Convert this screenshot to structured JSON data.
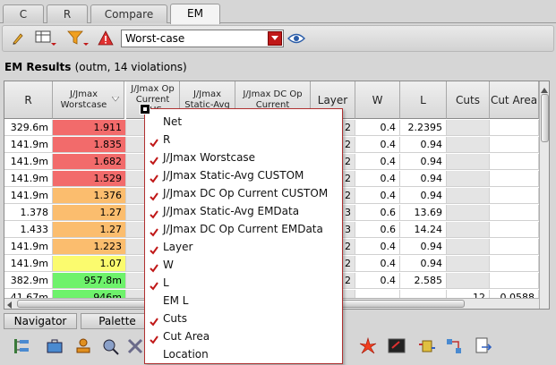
{
  "tabs": [
    {
      "label": "C",
      "active": false
    },
    {
      "label": "R",
      "active": false
    },
    {
      "label": "Compare",
      "active": false
    },
    {
      "label": "EM",
      "active": true
    }
  ],
  "toolbar": {
    "filter_value": "Worst-case",
    "icons": [
      "pencil-icon",
      "table-settings-icon",
      "filter-icon",
      "warning-icon",
      "eye-icon"
    ]
  },
  "results": {
    "title": "EM Results",
    "subtitle": "(outm, 14 violations)"
  },
  "columns": [
    {
      "label": "R"
    },
    {
      "label": "J/Jmax Worstcase"
    },
    {
      "label": "J/Jmax Op Current CUS"
    },
    {
      "label": "J/Jmax Static-Avg"
    },
    {
      "label": "J/Jmax DC Op Current"
    },
    {
      "label": "Layer"
    },
    {
      "label": "W"
    },
    {
      "label": "L"
    },
    {
      "label": "Cuts"
    },
    {
      "label": "Cut Area"
    }
  ],
  "rows": [
    {
      "r": "329.6m",
      "j": "1.911",
      "layer": "2",
      "w": "0.4",
      "l": "2.2395",
      "cuts": "",
      "cutarea": "",
      "color": "#f26b6b"
    },
    {
      "r": "141.9m",
      "j": "1.835",
      "layer": "2",
      "w": "0.4",
      "l": "0.94",
      "cuts": "",
      "cutarea": "",
      "color": "#f26b6b"
    },
    {
      "r": "141.9m",
      "j": "1.682",
      "layer": "2",
      "w": "0.4",
      "l": "0.94",
      "cuts": "",
      "cutarea": "",
      "color": "#f26b6b"
    },
    {
      "r": "141.9m",
      "j": "1.529",
      "layer": "2",
      "w": "0.4",
      "l": "0.94",
      "cuts": "",
      "cutarea": "",
      "color": "#f26b6b"
    },
    {
      "r": "141.9m",
      "j": "1.376",
      "layer": "2",
      "w": "0.4",
      "l": "0.94",
      "cuts": "",
      "cutarea": "",
      "color": "#fbbd6e"
    },
    {
      "r": "1.378",
      "j": "1.27",
      "layer": "3",
      "w": "0.6",
      "l": "13.69",
      "cuts": "",
      "cutarea": "",
      "color": "#fbbd6e"
    },
    {
      "r": "1.433",
      "j": "1.27",
      "layer": "3",
      "w": "0.6",
      "l": "14.24",
      "cuts": "",
      "cutarea": "",
      "color": "#fbbd6e"
    },
    {
      "r": "141.9m",
      "j": "1.223",
      "layer": "2",
      "w": "0.4",
      "l": "0.94",
      "cuts": "",
      "cutarea": "",
      "color": "#fbbd6e"
    },
    {
      "r": "141.9m",
      "j": "1.07",
      "layer": "2",
      "w": "0.4",
      "l": "0.94",
      "cuts": "",
      "cutarea": "",
      "color": "#fbfb6e"
    },
    {
      "r": "382.9m",
      "j": "957.8m",
      "layer": "2",
      "w": "0.4",
      "l": "2.585",
      "cuts": "",
      "cutarea": "",
      "color": "#6ef26b"
    },
    {
      "r": "41.67m",
      "j": "946m",
      "layer": "",
      "w": "",
      "l": "",
      "cuts": "12",
      "cutarea": "0.0588",
      "color": "#6ef26b"
    }
  ],
  "bottom_tabs": [
    {
      "label": "Navigator"
    },
    {
      "label": "Palette"
    }
  ],
  "column_menu": {
    "items": [
      {
        "label": "Net",
        "checked": false
      },
      {
        "label": "R",
        "checked": true
      },
      {
        "label": "J/Jmax Worstcase",
        "checked": true
      },
      {
        "label": "J/Jmax Static-Avg CUSTOM",
        "checked": true
      },
      {
        "label": "J/Jmax DC Op Current CUSTOM",
        "checked": true
      },
      {
        "label": "J/Jmax Static-Avg EMData",
        "checked": true
      },
      {
        "label": "J/Jmax DC Op Current EMData",
        "checked": true
      },
      {
        "label": "Layer",
        "checked": true
      },
      {
        "label": "W",
        "checked": true
      },
      {
        "label": "L",
        "checked": true
      },
      {
        "label": "EM L",
        "checked": false
      },
      {
        "label": "Cuts",
        "checked": true
      },
      {
        "label": "Cut Area",
        "checked": true
      },
      {
        "label": "Location",
        "checked": false
      }
    ]
  },
  "colors": {
    "red": "#f26b6b",
    "orange": "#fbbd6e",
    "yellow": "#fbfb6e",
    "green": "#6ef26b",
    "check": "#c01818"
  }
}
